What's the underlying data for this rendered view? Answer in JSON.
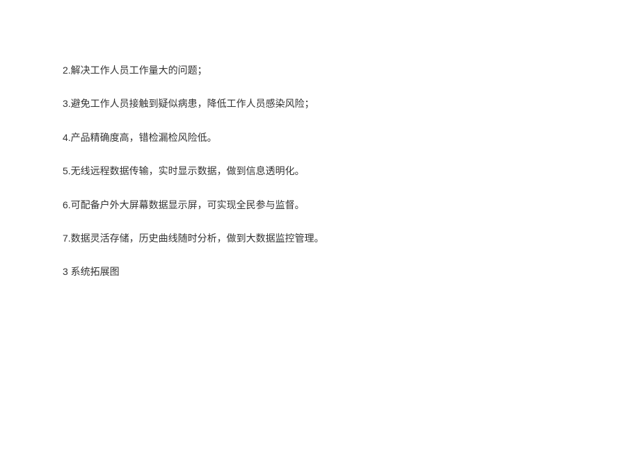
{
  "paragraphs": [
    "2.解决工作人员工作量大的问题；",
    "3.避免工作人员接触到疑似病患，降低工作人员感染风险；",
    "4.产品精确度高，错检漏检风险低。",
    "5.无线远程数据传输，实时显示数据，做到信息透明化。",
    "6.可配备户外大屏幕数据显示屏，可实现全民参与监督。",
    "7.数据灵活存储，历史曲线随时分析，做到大数据监控管理。"
  ],
  "heading": "3 系统拓展图"
}
